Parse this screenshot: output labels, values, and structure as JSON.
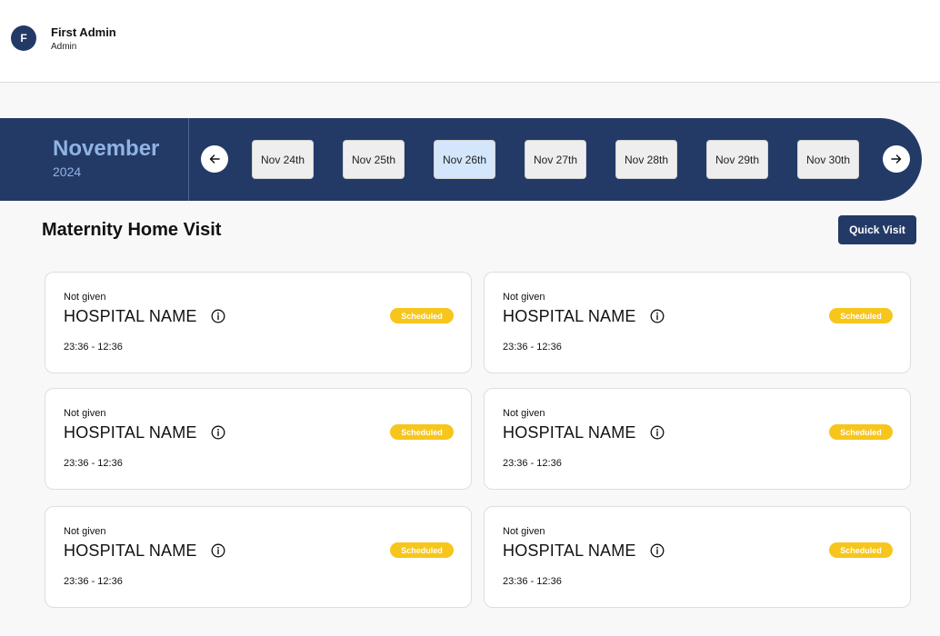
{
  "user": {
    "initial": "F",
    "name": "First Admin",
    "role": "Admin"
  },
  "calendar": {
    "month": "November",
    "year": "2024",
    "prev_icon": "arrow-left-icon",
    "next_icon": "arrow-right-icon",
    "days": [
      "Nov 24th",
      "Nov 25th",
      "Nov 26th",
      "Nov 27th",
      "Nov 28th",
      "Nov 29th",
      "Nov 30th"
    ],
    "selected_day": "Nov 26th"
  },
  "section": {
    "title": "Maternity Home Visit",
    "quick_visit_label": "Quick Visit"
  },
  "visits": [
    {
      "label": "Not given",
      "hospital": "HOSPITAL NAME",
      "status": "Scheduled",
      "time": "23:36 - 12:36"
    },
    {
      "label": "Not given",
      "hospital": "HOSPITAL NAME",
      "status": "Scheduled",
      "time": "23:36 - 12:36"
    },
    {
      "label": "Not given",
      "hospital": "HOSPITAL NAME",
      "status": "Scheduled",
      "time": "23:36 - 12:36"
    },
    {
      "label": "Not given",
      "hospital": "HOSPITAL NAME",
      "status": "Scheduled",
      "time": "23:36 - 12:36"
    },
    {
      "label": "Not given",
      "hospital": "HOSPITAL NAME",
      "status": "Scheduled",
      "time": "23:36 - 12:36"
    },
    {
      "label": "Not given",
      "hospital": "HOSPITAL NAME",
      "status": "Scheduled",
      "time": "23:36 - 12:36"
    }
  ],
  "colors": {
    "navy": "#243a66",
    "month_text": "#8fb3e3",
    "selected_day": "#d3e6fb",
    "badge": "#f7c61c"
  }
}
